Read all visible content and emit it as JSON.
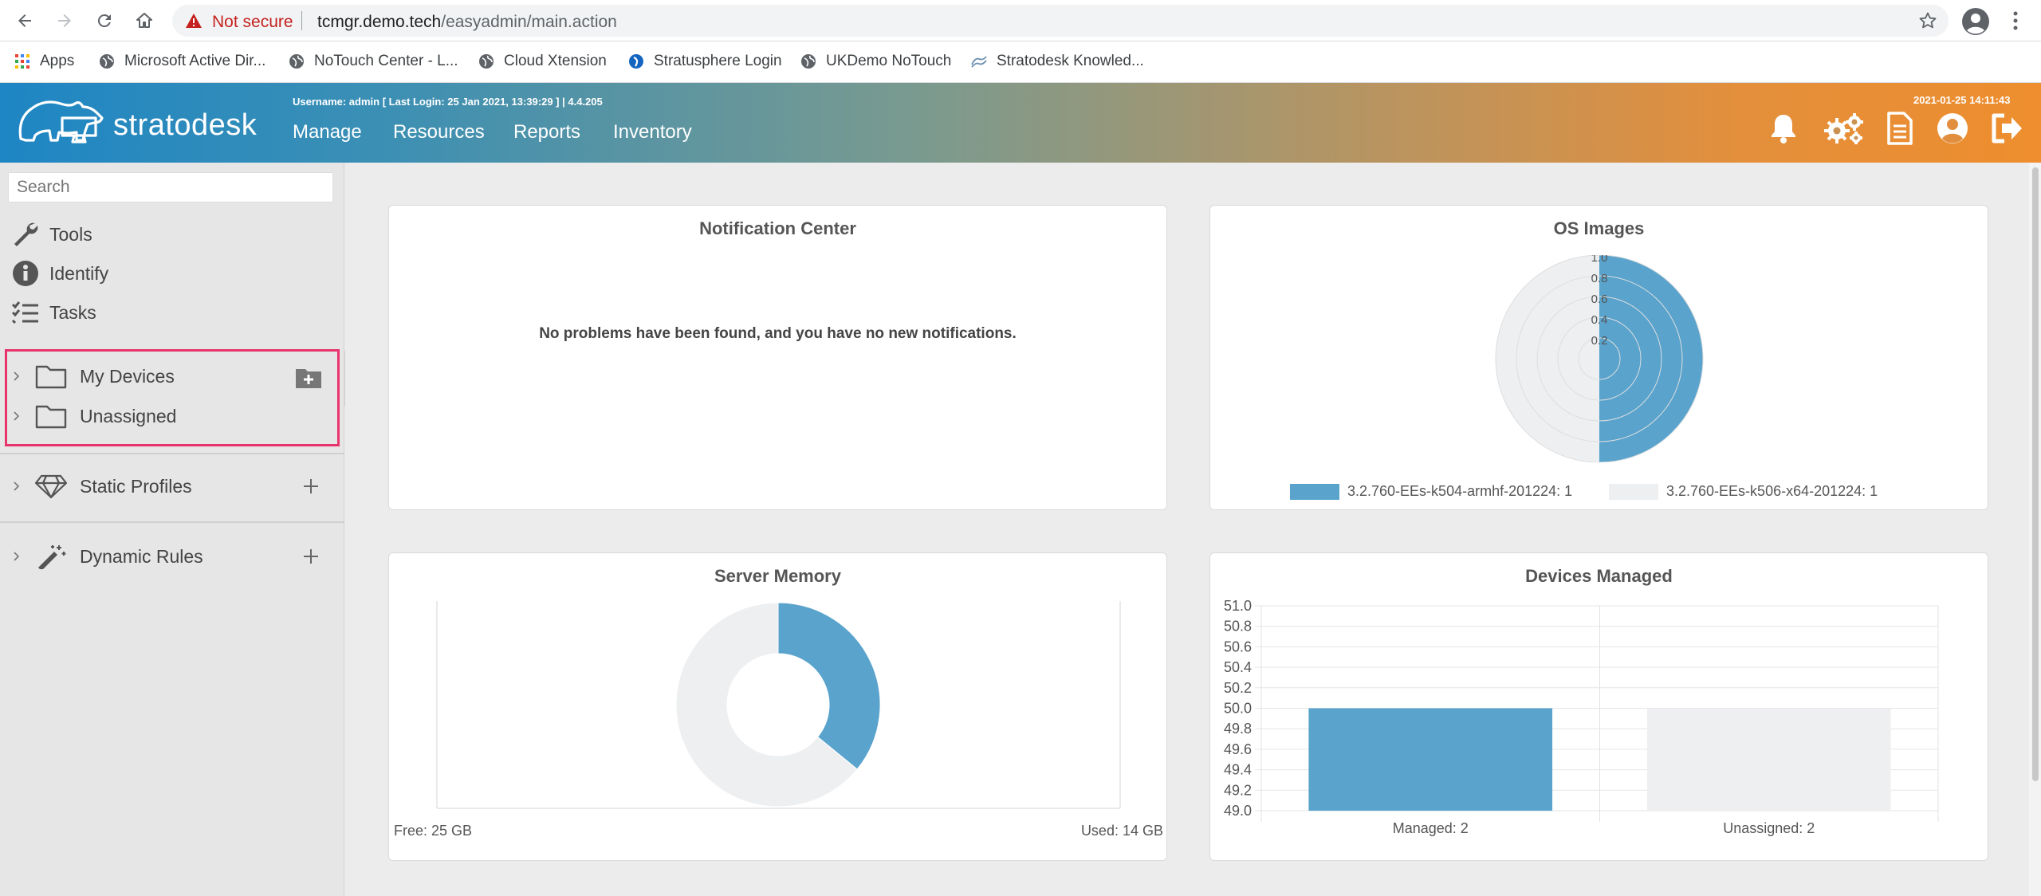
{
  "browser": {
    "not_secure_label": "Not secure",
    "url_host": "tcmgr.demo.tech",
    "url_path": "/easyadmin/main.action",
    "bookmarks": [
      {
        "label": "Apps",
        "icon": "apps-grid-icon"
      },
      {
        "label": "Microsoft Active Dir...",
        "icon": "globe-icon"
      },
      {
        "label": "NoTouch Center - L...",
        "icon": "globe-icon"
      },
      {
        "label": "Cloud Xtension",
        "icon": "globe-icon"
      },
      {
        "label": "Stratusphere Login",
        "icon": "stratusphere-icon"
      },
      {
        "label": "UKDemo NoTouch",
        "icon": "globe-icon"
      },
      {
        "label": "Stratodesk Knowled...",
        "icon": "stratodesk-icon"
      }
    ]
  },
  "header": {
    "logo_text": "stratodesk",
    "user_info": "Username: admin [ Last Login: 25 Jan 2021, 13:39:29 ]  |  4.4.205",
    "nav": [
      "Manage",
      "Resources",
      "Reports",
      "Inventory"
    ],
    "datetime": "2021-01-25 14:11:43",
    "icons": [
      "bell-icon",
      "gears-icon",
      "document-icon",
      "user-icon",
      "logout-icon"
    ]
  },
  "sidebar": {
    "search_placeholder": "Search",
    "menu": [
      "Tools",
      "Identify",
      "Tasks"
    ],
    "tree": [
      "My Devices",
      "Unassigned"
    ],
    "static_profiles": "Static Profiles",
    "dynamic_rules": "Dynamic Rules"
  },
  "panels": {
    "notification": {
      "title": "Notification Center",
      "message": "No problems have been found, and you have no new notifications."
    },
    "os_images": {
      "title": "OS Images"
    },
    "server_memory": {
      "title": "Server Memory",
      "free_label": "Free: 25 GB",
      "used_label": "Used: 14 GB"
    },
    "devices_managed": {
      "title": "Devices Managed"
    }
  },
  "chart_data": [
    {
      "type": "pie",
      "chart": "os_images",
      "title": "OS Images",
      "radial_ticks": [
        "0.2",
        "0.4",
        "0.6",
        "0.8",
        "1.0"
      ],
      "rlim": [
        0,
        1.0
      ],
      "legend": "bottom",
      "series": [
        {
          "name": "3.2.760-EEs-k504-armhf-201224",
          "legend_label": "3.2.760-EEs-k504-armhf-201224: 1",
          "value": 1,
          "color": "#59a3cd"
        },
        {
          "name": "3.2.760-EEs-k506-x64-201224",
          "legend_label": "3.2.760-EEs-k506-x64-201224: 1",
          "value": 1,
          "color": "#eeeff1"
        }
      ]
    },
    {
      "type": "pie",
      "chart": "server_memory",
      "title": "Server Memory",
      "series": [
        {
          "name": "Used",
          "value": 14,
          "color": "#59a3cd"
        },
        {
          "name": "Free",
          "value": 25,
          "color": "#eeeff1"
        }
      ]
    },
    {
      "type": "bar",
      "chart": "devices_managed",
      "title": "Devices Managed",
      "categories": [
        "Managed: 2",
        "Unassigned: 2"
      ],
      "values": [
        50.0,
        50.0
      ],
      "colors": [
        "#59a3cd",
        "#eeeff1"
      ],
      "ylim": [
        49.0,
        51.0
      ],
      "yticks": [
        "51.0",
        "50.8",
        "50.6",
        "50.4",
        "50.2",
        "50.0",
        "49.8",
        "49.6",
        "49.4",
        "49.2",
        "49.0"
      ],
      "grid": true
    }
  ]
}
